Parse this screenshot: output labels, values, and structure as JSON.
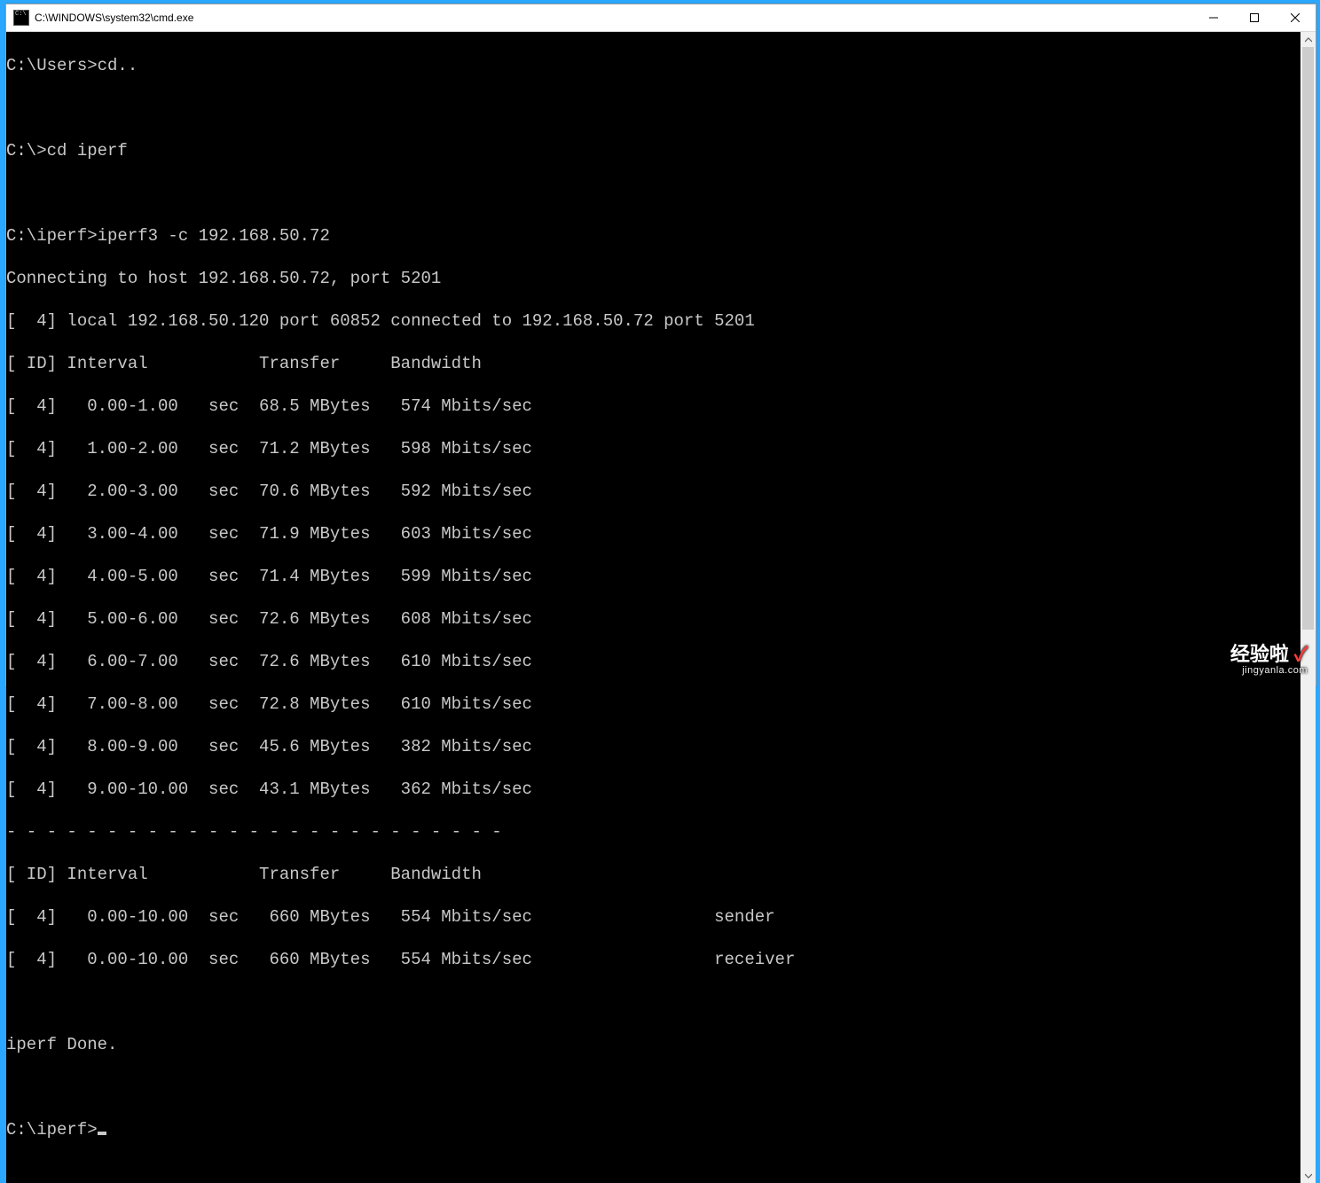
{
  "window": {
    "title": "C:\\WINDOWS\\system32\\cmd.exe"
  },
  "terminal": {
    "lines": {
      "l0": "C:\\Users>cd..",
      "l1": "",
      "l2": "C:\\>cd iperf",
      "l3": "",
      "l4": "C:\\iperf>iperf3 -c 192.168.50.72",
      "l5": "Connecting to host 192.168.50.72, port 5201",
      "l6": "[  4] local 192.168.50.120 port 60852 connected to 192.168.50.72 port 5201",
      "l7": "[ ID] Interval           Transfer     Bandwidth",
      "l8": "[  4]   0.00-1.00   sec  68.5 MBytes   574 Mbits/sec",
      "l9": "[  4]   1.00-2.00   sec  71.2 MBytes   598 Mbits/sec",
      "l10": "[  4]   2.00-3.00   sec  70.6 MBytes   592 Mbits/sec",
      "l11": "[  4]   3.00-4.00   sec  71.9 MBytes   603 Mbits/sec",
      "l12": "[  4]   4.00-5.00   sec  71.4 MBytes   599 Mbits/sec",
      "l13": "[  4]   5.00-6.00   sec  72.6 MBytes   608 Mbits/sec",
      "l14": "[  4]   6.00-7.00   sec  72.6 MBytes   610 Mbits/sec",
      "l15": "[  4]   7.00-8.00   sec  72.8 MBytes   610 Mbits/sec",
      "l16": "[  4]   8.00-9.00   sec  45.6 MBytes   382 Mbits/sec",
      "l17": "[  4]   9.00-10.00  sec  43.1 MBytes   362 Mbits/sec",
      "l18": "- - - - - - - - - - - - - - - - - - - - - - - - -",
      "l19": "[ ID] Interval           Transfer     Bandwidth",
      "l20": "[  4]   0.00-10.00  sec   660 MBytes   554 Mbits/sec                  sender",
      "l21": "[  4]   0.00-10.00  sec   660 MBytes   554 Mbits/sec                  receiver",
      "l22": "",
      "l23": "iperf Done.",
      "l24": "",
      "l25": "C:\\iperf>"
    }
  },
  "watermark": {
    "title": "经验啦",
    "check": "✓",
    "sub": "jingyanla.com"
  },
  "iperf_data": {
    "command": "iperf3 -c 192.168.50.72",
    "host": "192.168.50.72",
    "port": 5201,
    "local_ip": "192.168.50.120",
    "local_port": 60852,
    "intervals": [
      {
        "id": 4,
        "start": 0.0,
        "end": 1.0,
        "transfer_mbytes": 68.5,
        "bandwidth_mbits_sec": 574
      },
      {
        "id": 4,
        "start": 1.0,
        "end": 2.0,
        "transfer_mbytes": 71.2,
        "bandwidth_mbits_sec": 598
      },
      {
        "id": 4,
        "start": 2.0,
        "end": 3.0,
        "transfer_mbytes": 70.6,
        "bandwidth_mbits_sec": 592
      },
      {
        "id": 4,
        "start": 3.0,
        "end": 4.0,
        "transfer_mbytes": 71.9,
        "bandwidth_mbits_sec": 603
      },
      {
        "id": 4,
        "start": 4.0,
        "end": 5.0,
        "transfer_mbytes": 71.4,
        "bandwidth_mbits_sec": 599
      },
      {
        "id": 4,
        "start": 5.0,
        "end": 6.0,
        "transfer_mbytes": 72.6,
        "bandwidth_mbits_sec": 608
      },
      {
        "id": 4,
        "start": 6.0,
        "end": 7.0,
        "transfer_mbytes": 72.6,
        "bandwidth_mbits_sec": 610
      },
      {
        "id": 4,
        "start": 7.0,
        "end": 8.0,
        "transfer_mbytes": 72.8,
        "bandwidth_mbits_sec": 610
      },
      {
        "id": 4,
        "start": 8.0,
        "end": 9.0,
        "transfer_mbytes": 45.6,
        "bandwidth_mbits_sec": 382
      },
      {
        "id": 4,
        "start": 9.0,
        "end": 10.0,
        "transfer_mbytes": 43.1,
        "bandwidth_mbits_sec": 362
      }
    ],
    "summary": [
      {
        "id": 4,
        "start": 0.0,
        "end": 10.0,
        "transfer_mbytes": 660,
        "bandwidth_mbits_sec": 554,
        "role": "sender"
      },
      {
        "id": 4,
        "start": 0.0,
        "end": 10.0,
        "transfer_mbytes": 660,
        "bandwidth_mbits_sec": 554,
        "role": "receiver"
      }
    ],
    "done_message": "iperf Done."
  }
}
